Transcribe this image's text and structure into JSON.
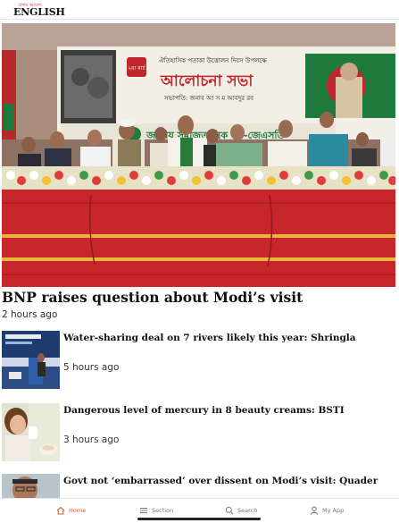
{
  "app": {
    "logo_small": "প্রথম আলো",
    "logo_main": "ENGLISH"
  },
  "lead": {
    "title": "BNP raises question about Modi’s visit",
    "time": "2 hours ago",
    "banner": {
      "date_badge": "২রা মার্চ",
      "line1": "ঐতিহাসিক পতাকা উত্তোলন দিবস উপলক্ষে",
      "line2": "আলোচনা সভা",
      "line3": "সভাপতি: জনাব আ স ম আবদুর রব",
      "line4": "জাতীয় সমাজতান্ত্রিক দল-জেএসডি"
    }
  },
  "stories": [
    {
      "title": "Water-sharing deal on 7 rivers likely this year: Shringla",
      "time": "5 hours ago",
      "thumb_icon": "press-briefing-photo"
    },
    {
      "title": "Dangerous level of mercury in 8 beauty creams: BSTI",
      "time": "3 hours ago",
      "thumb_icon": "beauty-cream-photo"
    },
    {
      "title": "Govt not ‘embarrassed’ over dissent on Modi’s visit: Quader",
      "time": "",
      "thumb_icon": "portrait-photo"
    }
  ],
  "tabs": [
    {
      "label": "Home",
      "icon": "home-icon",
      "active": true
    },
    {
      "label": "Section",
      "icon": "menu-icon",
      "active": false
    },
    {
      "label": "Search",
      "icon": "search-icon",
      "active": false
    },
    {
      "label": "My App",
      "icon": "user-icon",
      "active": false
    }
  ],
  "colors": {
    "accent": "#d4562a",
    "banner_green": "#1e7a3c",
    "banner_red": "#c0272d",
    "tablecloth_red": "#c7262b"
  }
}
